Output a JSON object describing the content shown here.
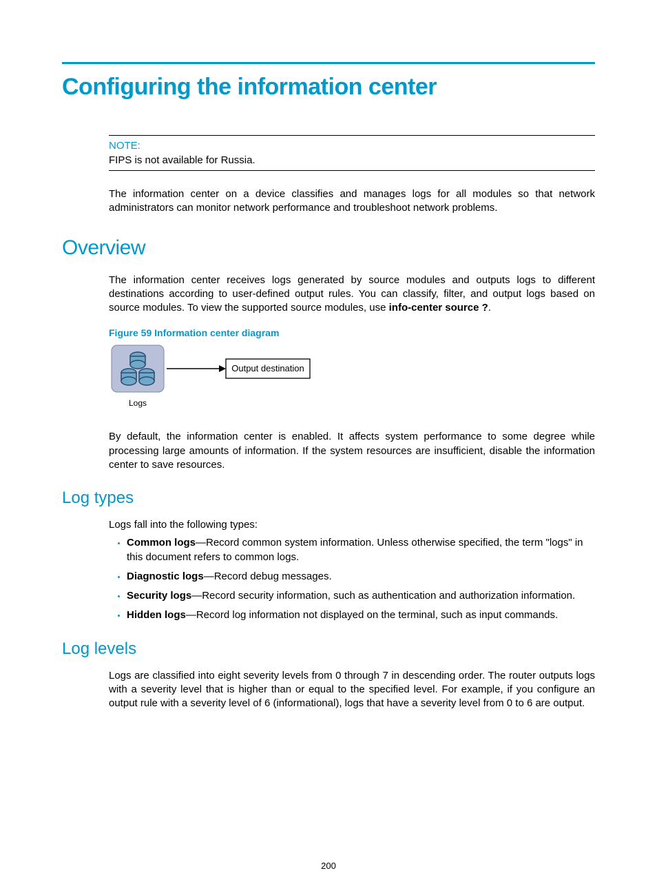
{
  "page_number": "200",
  "title": "Configuring the information center",
  "note": {
    "label": "NOTE:",
    "text": "FIPS is not available for Russia."
  },
  "intro_para": "The information center on a device classifies and manages logs for all modules so that network administrators can monitor network performance and troubleshoot network problems.",
  "overview": {
    "heading": "Overview",
    "para1_a": "The information center receives logs generated by source modules and outputs logs to different destinations according to user-defined output rules. You can classify, filter, and output logs based on source modules. To view the supported source modules, use ",
    "para1_cmd": "info-center source ?",
    "para1_b": ".",
    "fig_caption": "Figure 59 Information center diagram",
    "diagram": {
      "logs_label": "Logs",
      "dest_label": "Output destination"
    },
    "para2": "By default, the information center is enabled. It affects system performance to some degree while processing large amounts of information. If the system resources are insufficient, disable the information center to save resources."
  },
  "log_types": {
    "heading": "Log types",
    "lead": "Logs fall into the following types:",
    "items": [
      {
        "term": "Common logs",
        "desc": "—Record common system information. Unless otherwise specified, the term \"logs\" in this document refers to common logs."
      },
      {
        "term": "Diagnostic logs",
        "desc": "—Record debug messages."
      },
      {
        "term": "Security logs",
        "desc": "—Record security information, such as authentication and authorization information."
      },
      {
        "term": "Hidden logs",
        "desc": "—Record log information not displayed on the terminal, such as input commands."
      }
    ]
  },
  "log_levels": {
    "heading": "Log levels",
    "para": "Logs are classified into eight severity levels from 0 through 7 in descending order. The router outputs logs with a severity level that is higher than or equal to the specified level. For example, if you configure an output rule with a severity level of 6 (informational), logs that have a severity level from 0 to 6 are output."
  }
}
